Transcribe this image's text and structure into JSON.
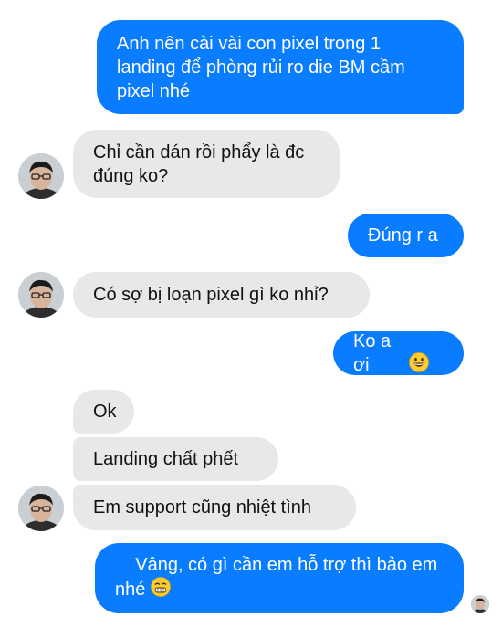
{
  "conversation": {
    "messages": [
      {
        "sender": "me",
        "text": "Anh nên cài vài con pixel trong 1 landing để phòng rủi ro die BM cầm pixel nhé"
      },
      {
        "sender": "contact",
        "text": "Chỉ cần dán rồi phẩy là đc đúng ko?"
      },
      {
        "sender": "me",
        "text": "Đúng r a"
      },
      {
        "sender": "contact",
        "text": "Có sợ bị loạn pixel gì ko nhỉ?"
      },
      {
        "sender": "me",
        "text": "Ko a ơi",
        "emoji": "grinning-face"
      },
      {
        "sender": "contact",
        "text": "Ok"
      },
      {
        "sender": "contact",
        "text": "Landing chất phết"
      },
      {
        "sender": "contact",
        "text": "Em support cũng nhiệt tình"
      },
      {
        "sender": "me",
        "text": "Vâng, có gì cần em hỗ trợ thì bảo em nhé",
        "emoji": "grimacing-face"
      }
    ]
  },
  "colors": {
    "outgoing_bubble": "#0a7cff",
    "incoming_bubble": "#e8e8ea",
    "outgoing_text": "#ffffff",
    "incoming_text": "#111111"
  },
  "icons": {
    "contact_avatar": "avatar-photo",
    "seen_indicator": "avatar-photo-small"
  }
}
